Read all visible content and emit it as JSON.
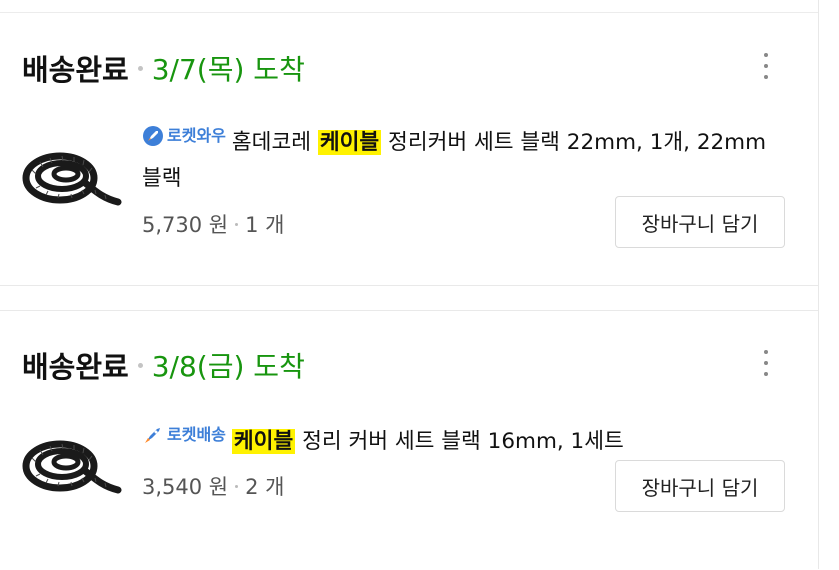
{
  "orders": [
    {
      "status": "배송완료",
      "arrival": "3/7(목) 도착",
      "badge": {
        "label": "로켓와우",
        "icon": "rocket-wow-icon",
        "color": "#3d7fd8"
      },
      "title_before": "홈데코레 ",
      "title_highlight": "케이블",
      "title_after": " 정리커버 세트 블랙 22mm, 1개, 22mm 블랙",
      "price": "5,730 원",
      "quantity": "1 개",
      "cart_button": "장바구니 담기",
      "image": "black-spiral-cable-wrap-image"
    },
    {
      "status": "배송완료",
      "arrival": "3/8(금) 도착",
      "badge": {
        "label": "로켓배송",
        "icon": "rocket-icon",
        "color": "#3d7fd8"
      },
      "title_before": "",
      "title_highlight": "케이블",
      "title_after": " 정리 커버 세트 블랙 16mm, 1세트",
      "price": "3,540 원",
      "quantity": "2 개",
      "cart_button": "장바구니 담기",
      "image": "black-spiral-cable-wrap-image"
    }
  ],
  "colors": {
    "arrival": "#18950f",
    "highlight": "#fff200",
    "badge": "#3d7fd8"
  }
}
